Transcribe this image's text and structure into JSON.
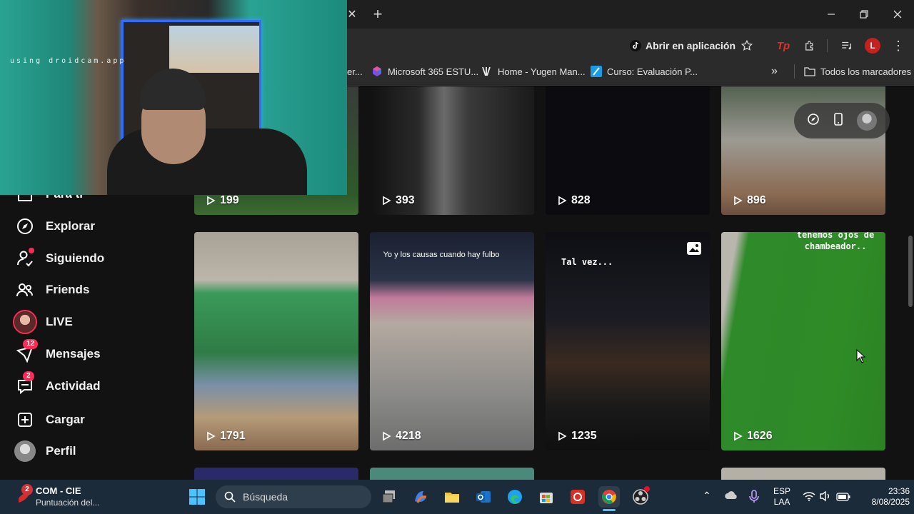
{
  "browser": {
    "open_app_label": "Abrir en aplicación",
    "profile_initial": "L",
    "bookmarks": [
      {
        "label": "er...",
        "icon": "bookmark-icon"
      },
      {
        "label": "Microsoft 365 ESTU...",
        "icon": "microsoft365-icon"
      },
      {
        "label": "Home - Yugen Man...",
        "icon": "yugen-icon"
      },
      {
        "label": "Curso: Evaluación P...",
        "icon": "course-icon"
      }
    ],
    "all_bookmarks_label": "Todos los marcadores"
  },
  "webcam": {
    "watermark": "using droidcam.app"
  },
  "sidebar": {
    "items": [
      {
        "label": "Para ti",
        "icon": "home-icon"
      },
      {
        "label": "Explorar",
        "icon": "compass-icon"
      },
      {
        "label": "Siguiendo",
        "icon": "following-icon"
      },
      {
        "label": "Friends",
        "icon": "friends-icon"
      },
      {
        "label": "LIVE",
        "icon": "live-icon"
      },
      {
        "label": "Mensajes",
        "icon": "messages-icon",
        "badge": "12"
      },
      {
        "label": "Actividad",
        "icon": "activity-icon",
        "badge": "2"
      },
      {
        "label": "Cargar",
        "icon": "upload-icon"
      },
      {
        "label": "Perfil",
        "icon": "profile-icon"
      }
    ]
  },
  "videos": {
    "row1": [
      {
        "views": "199"
      },
      {
        "views": "393"
      },
      {
        "views": "828"
      },
      {
        "views": "896"
      }
    ],
    "row2": [
      {
        "views": "1791"
      },
      {
        "views": "4218",
        "caption": "Yo y los causas cuando hay fulbo"
      },
      {
        "views": "1235",
        "caption": "Tal vez..."
      },
      {
        "views": "1626",
        "caption": "tenemos ojos de chambeador.."
      }
    ]
  },
  "taskbar": {
    "notification_badge": "2",
    "notification_title": "COM - CIE",
    "notification_subtitle": "Puntuación del...",
    "search_placeholder": "Búsqueda",
    "lang_line1": "ESP",
    "lang_line2": "LAA",
    "time": "23:36",
    "date": "8/08/2025"
  },
  "colors": {
    "accent": "#fe2c55",
    "page_bg": "#121212",
    "taskbar_bg": "#1c2b3a"
  }
}
